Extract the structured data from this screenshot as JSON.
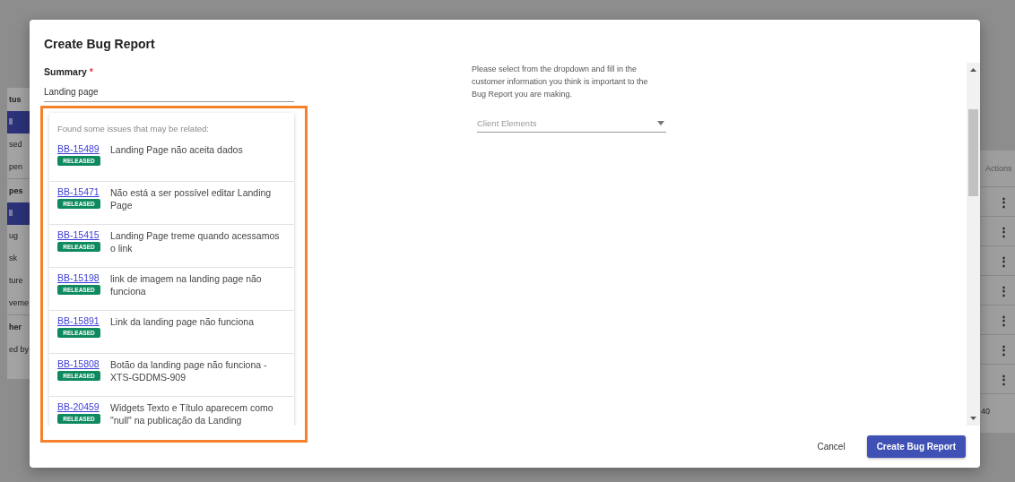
{
  "background": {
    "sidebar": [
      {
        "kind": "header",
        "label": "tus"
      },
      {
        "kind": "item",
        "label": "ll",
        "selected": true
      },
      {
        "kind": "item",
        "label": "sed",
        "selected": false
      },
      {
        "kind": "item",
        "label": "pen",
        "selected": false
      },
      {
        "kind": "header",
        "label": "pes"
      },
      {
        "kind": "item",
        "label": "ll",
        "selected": true
      },
      {
        "kind": "item",
        "label": "ug",
        "selected": false
      },
      {
        "kind": "item",
        "label": "sk",
        "selected": false
      },
      {
        "kind": "item",
        "label": "ture",
        "selected": false
      },
      {
        "kind": "item",
        "label": "veme",
        "selected": false
      },
      {
        "kind": "header",
        "label": "her"
      },
      {
        "kind": "item",
        "label": "ed by",
        "selected": false
      }
    ],
    "table": {
      "header": "Actions",
      "rows": [
        "⋮",
        "⋮",
        "⋮",
        "⋮",
        "⋮",
        "⋮",
        "⋮"
      ],
      "footer": "40"
    }
  },
  "dialog": {
    "title": "Create Bug Report",
    "summary": {
      "label": "Summary",
      "required_mark": "*",
      "value": "Landing page"
    },
    "related": {
      "heading": "Found some issues that may be related:",
      "issues": [
        {
          "key": "BB-15489",
          "status": "RELEASED",
          "title": "Landing Page não aceita dados"
        },
        {
          "key": "BB-15471",
          "status": "RELEASED",
          "title": "Não está a ser possível editar Landing Page"
        },
        {
          "key": "BB-15415",
          "status": "RELEASED",
          "title": "Landing Page treme quando acessamos o link"
        },
        {
          "key": "BB-15198",
          "status": "RELEASED",
          "title": "link de imagem na landing page não funciona"
        },
        {
          "key": "BB-15891",
          "status": "RELEASED",
          "title": "Link da landing page não funciona"
        },
        {
          "key": "BB-15808",
          "status": "RELEASED",
          "title": "Botão da landing page não funciona - XTS-GDDMS-909"
        },
        {
          "key": "BB-20459",
          "status": "RELEASED",
          "title": "Widgets Texto e Título aparecem como \"null\" na publicação da Landing"
        }
      ]
    },
    "instructions": "Please select from the dropdown and fill in the customer information you think is important to the Bug Report you are making.",
    "client_select": {
      "placeholder": "Client Elements"
    },
    "buttons": [
      {
        "kind": "text",
        "label": "Cancel"
      },
      {
        "kind": "primary",
        "label": "Create Bug Report"
      }
    ]
  }
}
